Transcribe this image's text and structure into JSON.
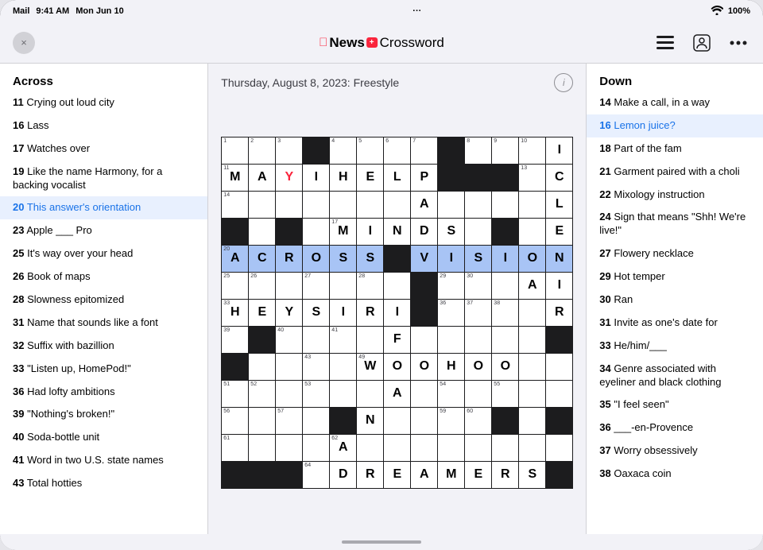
{
  "statusBar": {
    "carrier": "Mail",
    "time": "9:41 AM",
    "date": "Mon Jun 10",
    "dotsIcon": "···",
    "wifi": "wifi-icon",
    "battery": "100%"
  },
  "navBar": {
    "closeLabel": "×",
    "titleAppleLogo": "",
    "titleNewsPlus": "News+",
    "titleCrossword": " Crossword",
    "listIcon": "list-icon",
    "personIcon": "person-icon",
    "moreIcon": "more-icon"
  },
  "puzzle": {
    "date": "Thursday, August 8, 2023: Freestyle",
    "infoIcon": "i"
  },
  "acrossPanel": {
    "header": "Across",
    "clues": [
      {
        "number": "11",
        "text": "Crying out loud city"
      },
      {
        "number": "16",
        "text": "Lass"
      },
      {
        "number": "17",
        "text": "Watches over"
      },
      {
        "number": "19",
        "text": "Like the name Harmony, for a backing vocalist"
      },
      {
        "number": "20",
        "text": "This answer's orientation",
        "active": true
      },
      {
        "number": "23",
        "text": "Apple ___ Pro"
      },
      {
        "number": "25",
        "text": "It's way over your head"
      },
      {
        "number": "26",
        "text": "Book of maps"
      },
      {
        "number": "28",
        "text": "Slowness epitomized"
      },
      {
        "number": "31",
        "text": "Name that sounds like a font"
      },
      {
        "number": "32",
        "text": "Suffix with bazillion"
      },
      {
        "number": "33",
        "text": "\"Listen up, HomePod!\""
      },
      {
        "number": "36",
        "text": "Had lofty ambitions"
      },
      {
        "number": "39",
        "text": "\"Nothing's broken!\""
      },
      {
        "number": "40",
        "text": "Soda-bottle unit"
      },
      {
        "number": "41",
        "text": "Word in two U.S. state names"
      },
      {
        "number": "43",
        "text": "Total hotties"
      }
    ]
  },
  "downPanel": {
    "header": "Down",
    "clues": [
      {
        "number": "14",
        "text": "Make a call, in a way"
      },
      {
        "number": "16",
        "text": "Lemon juice?",
        "active": true
      },
      {
        "number": "18",
        "text": "Part of the fam"
      },
      {
        "number": "21",
        "text": "Garment paired with a choli"
      },
      {
        "number": "22",
        "text": "Mixology instruction"
      },
      {
        "number": "24",
        "text": "Sign that means \"Shh! We're live!\""
      },
      {
        "number": "27",
        "text": "Flowery necklace"
      },
      {
        "number": "29",
        "text": "Hot temper"
      },
      {
        "number": "30",
        "text": "Ran"
      },
      {
        "number": "31",
        "text": "Invite as one's date for"
      },
      {
        "number": "33",
        "text": "He/him/___"
      },
      {
        "number": "34",
        "text": "Genre associated with eyeliner and black clothing"
      },
      {
        "number": "35",
        "text": "\"I feel seen\""
      },
      {
        "number": "36",
        "text": "___-en-Provence"
      },
      {
        "number": "37",
        "text": "Worry obsessively"
      },
      {
        "number": "38",
        "text": "Oaxaca coin"
      }
    ]
  },
  "grid": {
    "rows": 13,
    "cols": 13
  }
}
